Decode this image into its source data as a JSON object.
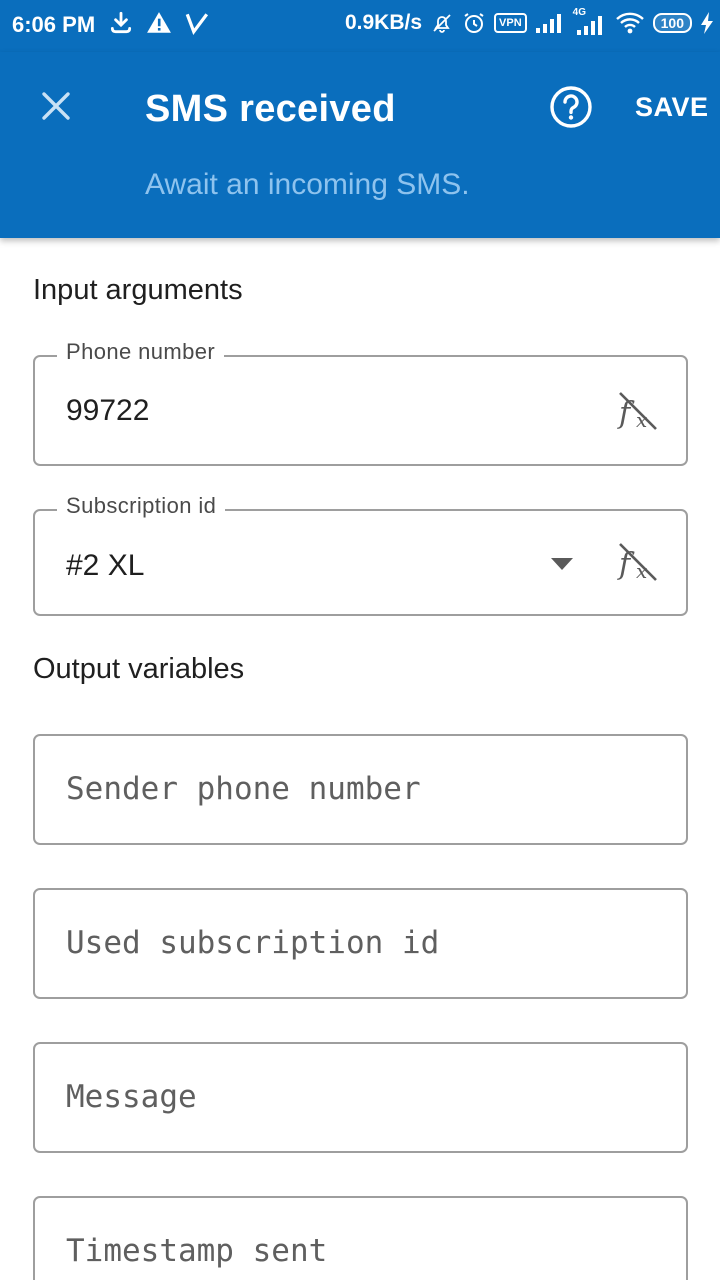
{
  "status_bar": {
    "time": "6:06 PM",
    "speed": "0.9KB/s",
    "vpn": "VPN",
    "network": "4G",
    "battery": "100",
    "icons": [
      "download-icon",
      "warning-icon",
      "v-icon",
      "mute-icon",
      "alarm-icon",
      "vpn-icon",
      "signal-icon",
      "signal-4g-icon",
      "wifi-icon",
      "battery-icon",
      "charging-icon"
    ]
  },
  "app_bar": {
    "title": "SMS received",
    "subtitle": "Await an incoming SMS.",
    "save_label": "SAVE",
    "background": "#0A6EBD"
  },
  "input_section": {
    "title": "Input arguments",
    "phone_number": {
      "label": "Phone number",
      "value": "99722"
    },
    "subscription_id": {
      "label": "Subscription id",
      "value": "#2 XL"
    }
  },
  "output_section": {
    "title": "Output variables",
    "fields": [
      {
        "placeholder": "Sender phone number"
      },
      {
        "placeholder": "Used subscription id"
      },
      {
        "placeholder": "Message"
      },
      {
        "placeholder": "Timestamp sent"
      }
    ]
  }
}
